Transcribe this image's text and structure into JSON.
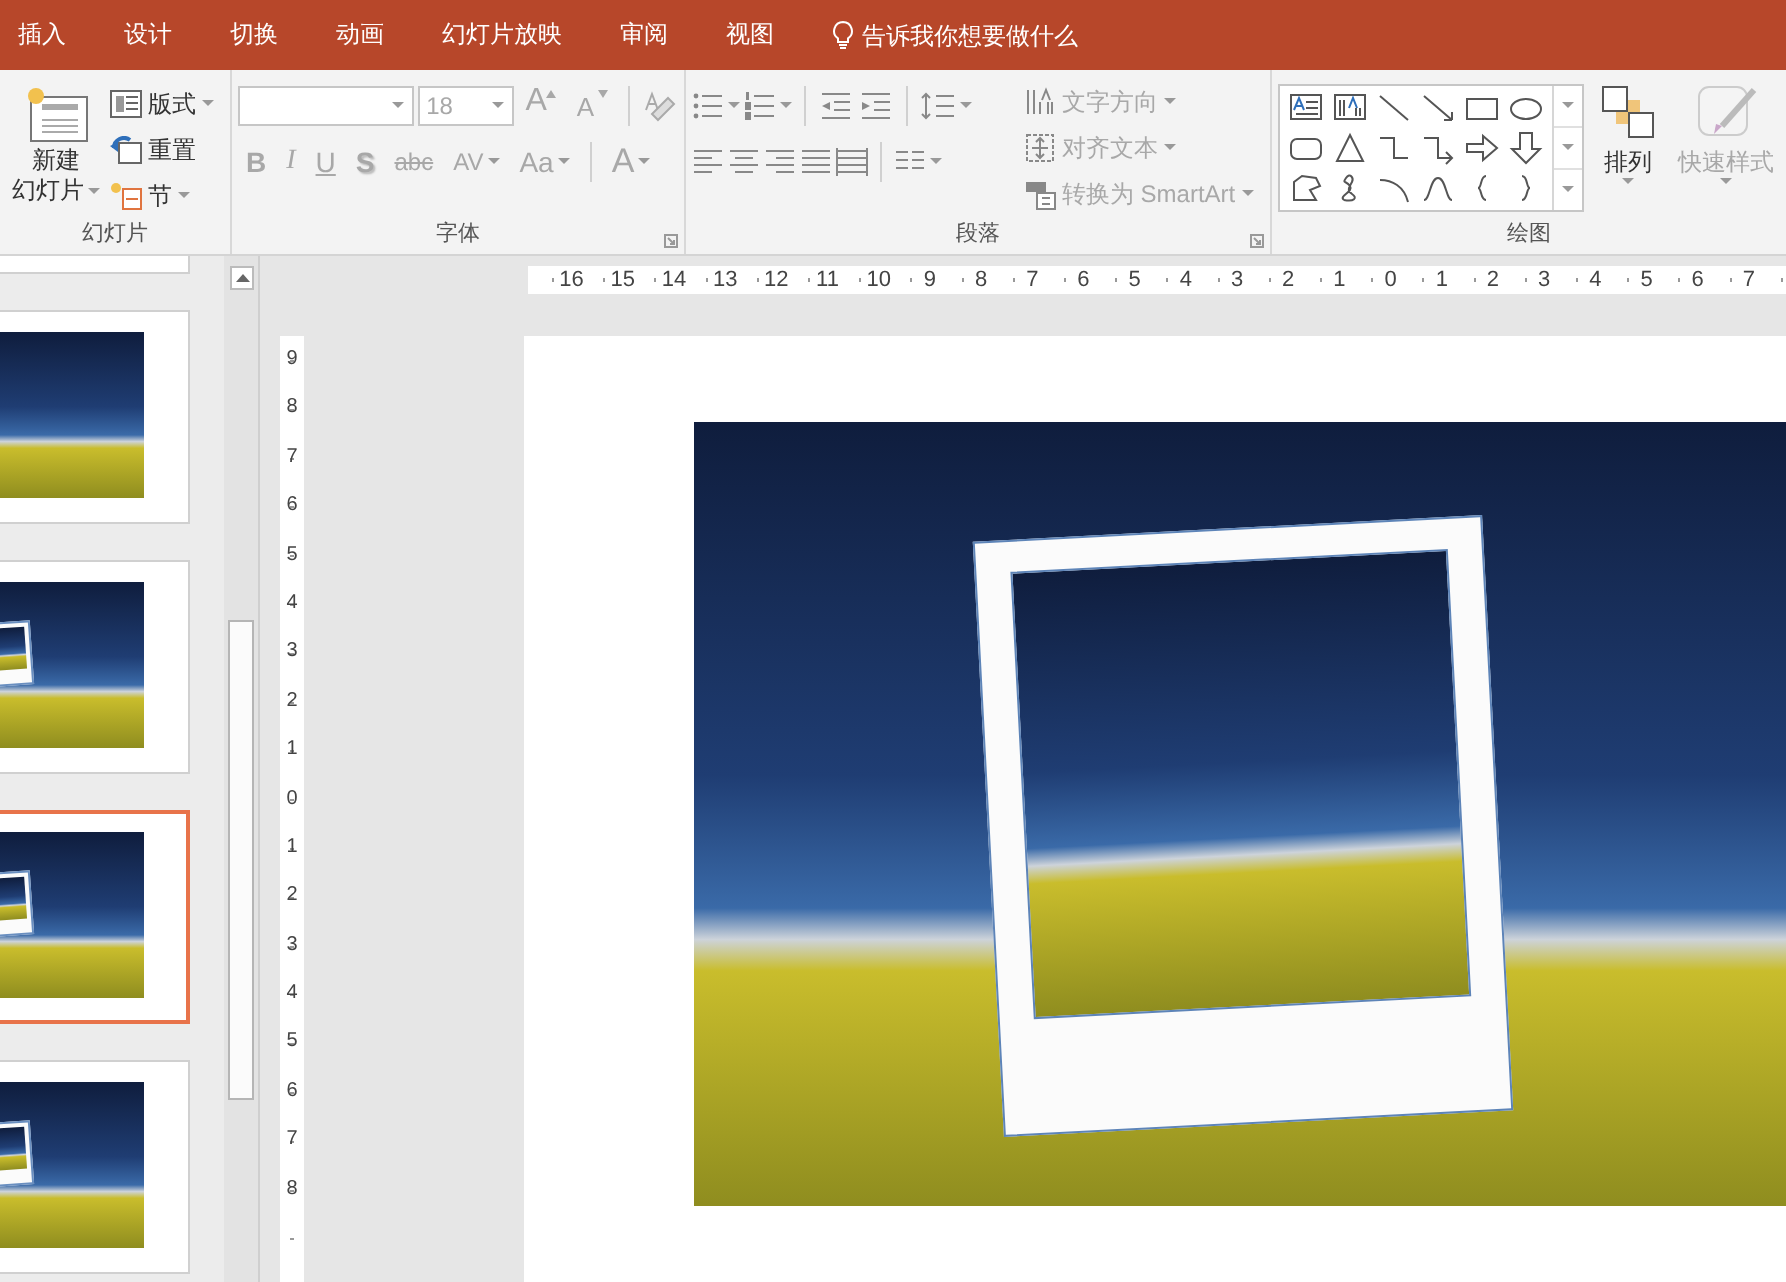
{
  "tabs": [
    {
      "label": "插入",
      "selected": false
    },
    {
      "label": "设计",
      "selected": false
    },
    {
      "label": "切换",
      "selected": false
    },
    {
      "label": "动画",
      "selected": false
    },
    {
      "label": "幻灯片放映",
      "selected": false
    },
    {
      "label": "审阅",
      "selected": false
    },
    {
      "label": "视图",
      "selected": false
    }
  ],
  "tell_me": {
    "placeholder": "告诉我你想要做什么"
  },
  "slides_group": {
    "label": "幻灯片",
    "disabled": false,
    "new_slide": {
      "line_1": "新建",
      "line_2": "幻灯片"
    },
    "buttons": [
      {
        "label": "版式",
        "kind": "layout",
        "dropdown": true
      },
      {
        "label": "重置",
        "kind": "reset",
        "dropdown": false
      },
      {
        "label": "节",
        "kind": "section",
        "dropdown": true
      }
    ]
  },
  "font_group": {
    "label": "字体",
    "disabled": true,
    "font_size": {
      "value": "18"
    },
    "size_buttons": [
      {
        "label": "A",
        "kind": "grow"
      },
      {
        "label": "A",
        "kind": "shrink"
      }
    ],
    "format_buttons": [
      {
        "label": "B",
        "kind": "bold",
        "dropdown": false
      },
      {
        "label": "I",
        "kind": "italic",
        "dropdown": false
      },
      {
        "label": "U",
        "kind": "underline",
        "dropdown": false
      },
      {
        "label": "S",
        "kind": "shadow",
        "dropdown": false
      },
      {
        "label": "abc",
        "kind": "strike",
        "dropdown": false
      },
      {
        "label": "AV",
        "kind": "spacing",
        "dropdown": true
      },
      {
        "label": "Aa",
        "kind": "case",
        "dropdown": true
      },
      {
        "label": "A",
        "kind": "color",
        "dropdown": true
      }
    ]
  },
  "paragraph_group": {
    "label": "段落",
    "disabled": true,
    "text_buttons": [
      {
        "label": "文字方向",
        "kind": "direction"
      },
      {
        "label": "对齐文本",
        "kind": "align"
      },
      {
        "label": "转换为 SmartArt",
        "kind": "smartart"
      }
    ]
  },
  "drawing_group": {
    "label": "绘图",
    "buttons": [
      {
        "label": "排列",
        "kind": "arrange",
        "disabled": false
      },
      {
        "label": "快速样式",
        "kind": "styles",
        "disabled": true
      }
    ]
  },
  "slide_thumbnails": [
    {
      "selected": false
    },
    {
      "selected": false,
      "framed": false
    },
    {
      "selected": false,
      "framed": true
    },
    {
      "selected": true,
      "framed": true
    },
    {
      "selected": false,
      "framed": true
    }
  ],
  "horizontal_ruler": {
    "labels": [
      "16",
      "15",
      "14",
      "13",
      "12",
      "11",
      "10",
      "9",
      "8",
      "7",
      "6",
      "5",
      "4",
      "3",
      "2",
      "1",
      "0",
      "1",
      "2",
      "3",
      "4",
      "5",
      "6",
      "7"
    ]
  },
  "vertical_ruler": {
    "labels": [
      "9",
      "8",
      "7",
      "6",
      "5",
      "4",
      "3",
      "2",
      "1",
      "0",
      "1",
      "2",
      "3",
      "4",
      "5",
      "6",
      "7",
      "8"
    ]
  }
}
